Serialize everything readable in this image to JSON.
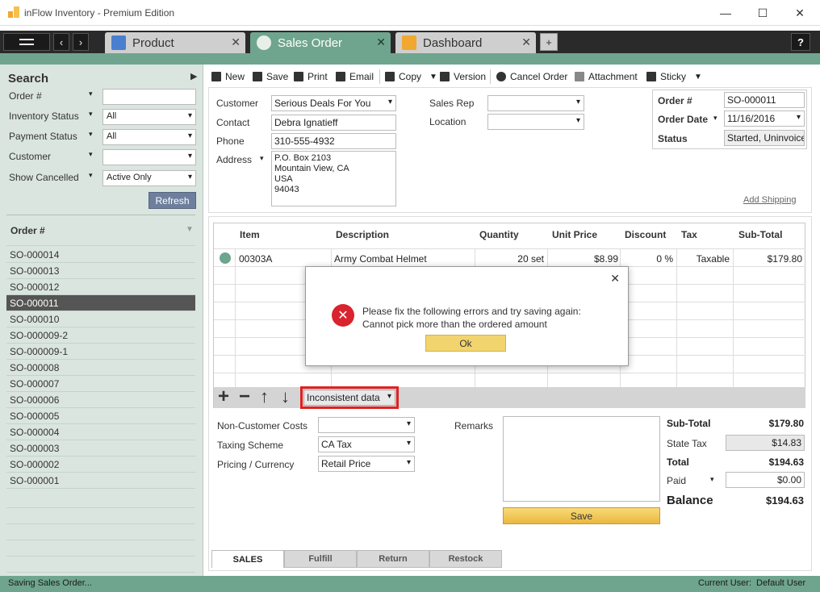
{
  "window": {
    "title": "inFlow Inventory - Premium Edition",
    "minimize": "—",
    "maximize": "☐",
    "close": "✕"
  },
  "tabs": [
    {
      "label": "Product",
      "close": "✕"
    },
    {
      "label": "Sales Order",
      "close": "✕"
    },
    {
      "label": "Dashboard",
      "close": "✕"
    }
  ],
  "tab_add": "+",
  "help": "?",
  "sidebar": {
    "title": "Search",
    "filters": {
      "order_no": {
        "label": "Order #",
        "value": ""
      },
      "inventory_status": {
        "label": "Inventory Status",
        "value": "All"
      },
      "payment_status": {
        "label": "Payment Status",
        "value": "All"
      },
      "customer": {
        "label": "Customer",
        "value": ""
      },
      "show_cancelled": {
        "label": "Show Cancelled",
        "value": "Active Only"
      }
    },
    "refresh": "Refresh",
    "list_header": "Order #",
    "orders": [
      "SO-000014",
      "SO-000013",
      "SO-000012",
      "SO-000011",
      "SO-000010",
      "SO-000009-2",
      "SO-000009-1",
      "SO-000008",
      "SO-000007",
      "SO-000006",
      "SO-000005",
      "SO-000004",
      "SO-000003",
      "SO-000002",
      "SO-000001"
    ],
    "selected_index": 3
  },
  "toolbar": {
    "new": "New",
    "save": "Save",
    "print": "Print",
    "email": "Email",
    "copy": "Copy",
    "version": "Version",
    "cancel_order": "Cancel Order",
    "attachment": "Attachment",
    "sticky": "Sticky"
  },
  "customer_info": {
    "customer_label": "Customer",
    "customer": "Serious Deals For You",
    "contact_label": "Contact",
    "contact": "Debra Ignatieff",
    "phone_label": "Phone",
    "phone": "310-555-4932",
    "address_label": "Address",
    "address_lines": [
      "P.O. Box 2103",
      "Mountain View, CA",
      "USA",
      "94043"
    ],
    "sales_rep_label": "Sales Rep",
    "sales_rep": "",
    "location_label": "Location",
    "location": ""
  },
  "order_info": {
    "order_no_label": "Order #",
    "order_no": "SO-000011",
    "order_date_label": "Order Date",
    "order_date": "11/16/2016",
    "status_label": "Status",
    "status": "Started, Uninvoiced"
  },
  "add_shipping": "Add Shipping",
  "grid": {
    "headers": {
      "item": "Item",
      "description": "Description",
      "quantity": "Quantity",
      "unit_price": "Unit Price",
      "discount": "Discount",
      "tax": "Tax",
      "subtotal": "Sub-Total"
    },
    "rows": [
      {
        "item": "00303A",
        "description": "Army Combat Helmet",
        "quantity": "20 set",
        "unit_price": "$8.99",
        "discount": "0 %",
        "tax": "Taxable",
        "subtotal": "$179.80"
      }
    ]
  },
  "grid_tools": {
    "add": "+",
    "remove": "−",
    "up": "↑",
    "down": "↓",
    "inconsistent": "Inconsistent data"
  },
  "costs": {
    "non_customer_costs_label": "Non-Customer Costs",
    "non_customer_costs": "",
    "taxing_scheme_label": "Taxing Scheme",
    "taxing_scheme": "CA Tax",
    "pricing_label": "Pricing / Currency",
    "pricing": "Retail Price"
  },
  "remarks_label": "Remarks",
  "save_button": "Save",
  "totals": {
    "subtotal_label": "Sub-Total",
    "subtotal": "$179.80",
    "state_tax_label": "State Tax",
    "state_tax": "$14.83",
    "total_label": "Total",
    "total": "$194.63",
    "paid_label": "Paid",
    "paid": "$0.00",
    "balance_label": "Balance",
    "balance": "$194.63"
  },
  "bottom_tabs": [
    "SALES",
    "Fulfill",
    "Return",
    "Restock"
  ],
  "dialog": {
    "line1": "Please fix the following errors and try saving again:",
    "line2": "Cannot pick more than the ordered amount",
    "ok": "Ok",
    "close": "✕"
  },
  "status": {
    "left": "Saving Sales Order...",
    "user_label": "Current User:",
    "user": "Default User"
  },
  "colors": {
    "accent_green": "#6fa58e",
    "error_red": "#d9232e",
    "highlight_red": "#e02020",
    "ok_yellow": "#f2d46e"
  }
}
